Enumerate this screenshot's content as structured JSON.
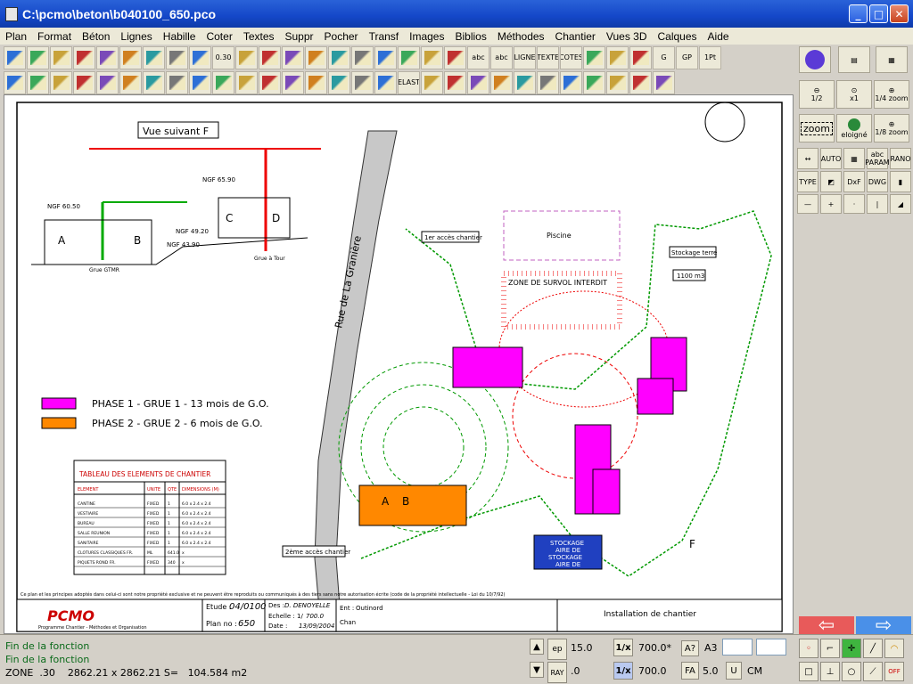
{
  "window": {
    "title": "C:\\pcmo\\beton\\b040100_650.pco",
    "minimize": "_",
    "maximize": "□",
    "close": "✕"
  },
  "menu": [
    "Plan",
    "Format",
    "Béton",
    "Lignes",
    "Habille",
    "Coter",
    "Textes",
    "Suppr",
    "Pocher",
    "Transf",
    "Images",
    "Biblios",
    "Méthodes",
    "Chantier",
    "Vues 3D",
    "Calques",
    "Aide"
  ],
  "toolbar1": [
    "",
    "",
    "",
    "",
    "",
    "",
    "",
    "",
    "",
    "0.30",
    "",
    "",
    "",
    "",
    "",
    "",
    "",
    "",
    "",
    "",
    "abc",
    "abc",
    "LIGNE",
    "TEXTE",
    "COTES",
    "",
    "",
    "",
    "G",
    "GP",
    "1Pt"
  ],
  "toolbar2": [
    "",
    "",
    "",
    "",
    "",
    "",
    "",
    "",
    "",
    "",
    "",
    "",
    "",
    "",
    "",
    "",
    "",
    "ELAST",
    "",
    "",
    "",
    "",
    "",
    "",
    "",
    "",
    "",
    "",
    ""
  ],
  "right": {
    "zoom_half": "1/2",
    "zoom_x1": "x1",
    "zoom_quarter": "1/4 zoom",
    "zoom": "zoom",
    "eloigne": "eloigné",
    "zoom_eighth": "1/8 zoom",
    "type": "TYPE",
    "auto": "AUTO",
    "param": "PARAM",
    "abc": "abc",
    "dxf": "DxF",
    "dwg": "DWG",
    "rano": "RANO"
  },
  "drawing": {
    "vue_title": "Vue suivant F",
    "phase1": "PHASE 1 - GRUE 1 - 13 mois de G.O.",
    "phase2": "PHASE 2 - GRUE 2  -  6 mois de G.O.",
    "road": "Rue de La Granière",
    "zone_survol": "ZONE DE SURVOL INTERDIT",
    "access1": "1er accès chantier",
    "access2": "2ème accès chantier",
    "piscine": "Piscine",
    "stockage_terre": "Stockage terre",
    "volume": "1100 m3",
    "stockage": [
      "STOCKAGE",
      "AIRE DE",
      "STOCKAGE",
      "AIRE DE"
    ],
    "ngf_labels": [
      "NGF 60.50",
      "NGF 65.90",
      "NGF 49.20",
      "NGF 43.90"
    ],
    "crane_left": "Grue GTMR",
    "crane_right": "Grue à Tour",
    "blocks": [
      "A",
      "B",
      "C",
      "D"
    ],
    "north_marker": "F",
    "table_title": "TABLEAU DES ELEMENTS DE CHANTIER",
    "table_head": [
      "ELEMENT",
      "UNITE",
      "QTE",
      "DIMENSIONS (M)"
    ],
    "table_rows": [
      [
        "CANTINE",
        "FIXED",
        "1",
        "6.0 x 2.4 x 2.4"
      ],
      [
        "VESTIAIRE",
        "FIXED",
        "1",
        "6.0 x 2.4 x 2.4"
      ],
      [
        "BUREAU",
        "FIXED",
        "1",
        "6.0 x 2.4 x 2.4"
      ],
      [
        "SALLE REUNION",
        "FIXED",
        "1",
        "6.0 x 2.4 x 2.4"
      ],
      [
        "SANITAIRE",
        "FIXED",
        "1",
        "6.0 x 2.4 x 2.4"
      ],
      [
        "CLOTURES CLASSIQUES FR.",
        "ML",
        "641.0",
        "x"
      ],
      [
        "PIQUETS ROND FR.",
        "FIXED",
        "340",
        "x"
      ]
    ],
    "footer_note": "Ce plan et les principes adoptés dans celui-ci sont notre propriété exclusive et ne peuvent être reproduits ou communiqués à des tiers sans notre autorisation écrite (code de la propriété intellectuelle - Loi du 10/7/92)",
    "cartouche": {
      "etude_label": "Etude :",
      "etude": "04/0100",
      "plan_label": "Plan no :",
      "plan": "650",
      "des_label": "Des :",
      "des": "D. DENOYELLE",
      "echelle_label": "Echelle : 1/",
      "echelle": "700.0",
      "date_label": "Date :",
      "date": "13/09/2004",
      "ent_label": "Ent :",
      "ent": "Outinord",
      "chan_label": "Chan",
      "title": "Installation de chantier",
      "logo": "PCMO",
      "logo_sub": "Programme Chantier - Méthodes et Organisation"
    }
  },
  "status": {
    "msg1": "Fin de la fonction",
    "msg2": "Fin de la fonction",
    "zone_label": "ZONE",
    "zone_value": ".30",
    "dims": "2862.21 x 2862.21 S=",
    "area": "104.584 m2",
    "ep_label": "ep",
    "ep_value": "15.0",
    "ray_label": "RAY",
    "ray_value": ".0",
    "scale1_label": "1/x",
    "scale1_value": "700.0*",
    "scale2_label": "1/x",
    "scale2_value": "700.0",
    "question": "A?",
    "format": "A3",
    "fa": "FA",
    "fa_value": "5.0",
    "u": "U",
    "cm": "CM",
    "off": "OFF"
  }
}
